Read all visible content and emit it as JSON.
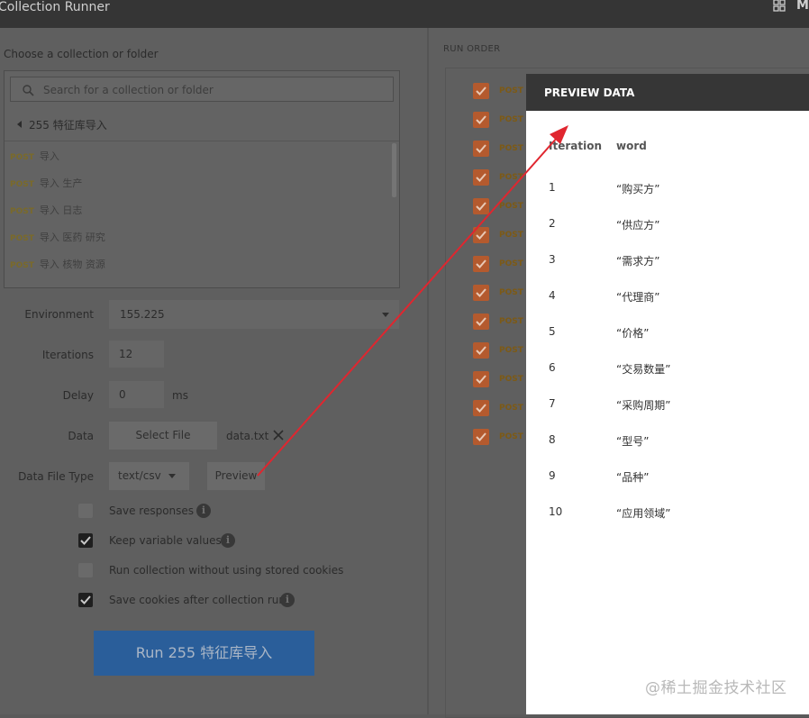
{
  "app": {
    "title": "Collection Runner",
    "user": "My"
  },
  "left": {
    "choose_label": "Choose a collection or folder",
    "search_placeholder": "Search for a collection or folder",
    "breadcrumb": "255 特征库导入",
    "requests": [
      {
        "method": "POST",
        "name": "导入"
      },
      {
        "method": "POST",
        "name": "导入 生产"
      },
      {
        "method": "POST",
        "name": "导入 日志"
      },
      {
        "method": "POST",
        "name": "导入 医药 研究"
      },
      {
        "method": "POST",
        "name": "导入 核物 资源"
      }
    ],
    "environment_label": "Environment",
    "environment_value": "155.225",
    "iterations_label": "Iterations",
    "iterations_value": "12",
    "delay_label": "Delay",
    "delay_value": "0",
    "delay_unit": "ms",
    "data_label": "Data",
    "select_file_label": "Select File",
    "file_name": "data.txt",
    "data_file_type_label": "Data File Type",
    "data_file_type_value": "text/csv",
    "preview_label": "Preview",
    "options": [
      {
        "label": "Save responses",
        "checked": false,
        "info": true
      },
      {
        "label": "Keep variable values",
        "checked": true,
        "info": true
      },
      {
        "label": "Run collection without using stored cookies",
        "checked": false,
        "info": false
      },
      {
        "label": "Save cookies after collection run",
        "checked": true,
        "info": true
      }
    ],
    "run_button": "Run 255 特征库导入"
  },
  "right": {
    "run_order_label": "RUN ORDER",
    "items": [
      {
        "method": "POST",
        "checked": true
      },
      {
        "method": "POST",
        "checked": true
      },
      {
        "method": "POST",
        "checked": true
      },
      {
        "method": "POST",
        "checked": true
      },
      {
        "method": "POST",
        "checked": true
      },
      {
        "method": "POST",
        "checked": true
      },
      {
        "method": "POST",
        "checked": true
      },
      {
        "method": "POST",
        "checked": true
      },
      {
        "method": "POST",
        "checked": true
      },
      {
        "method": "POST",
        "checked": true
      },
      {
        "method": "POST",
        "checked": true
      },
      {
        "method": "POST",
        "checked": true
      },
      {
        "method": "POST",
        "checked": true
      }
    ]
  },
  "preview": {
    "title": "PREVIEW DATA",
    "col_iteration": "Iteration",
    "col_word": "word",
    "rows": [
      {
        "i": "1",
        "w": "“购买方”"
      },
      {
        "i": "2",
        "w": "“供应方”"
      },
      {
        "i": "3",
        "w": "“需求方”"
      },
      {
        "i": "4",
        "w": "“代理商”"
      },
      {
        "i": "5",
        "w": "“价格”"
      },
      {
        "i": "6",
        "w": "“交易数量”"
      },
      {
        "i": "7",
        "w": "“采购周期”"
      },
      {
        "i": "8",
        "w": "“型号”"
      },
      {
        "i": "9",
        "w": "“品种”"
      },
      {
        "i": "10",
        "w": "“应用领域”"
      }
    ]
  },
  "watermark": "@稀土掘金技术社区",
  "colors": {
    "accent_orange": "#b45a2e",
    "run_blue": "#2a5e9a",
    "arrow_red": "#e0262f"
  }
}
